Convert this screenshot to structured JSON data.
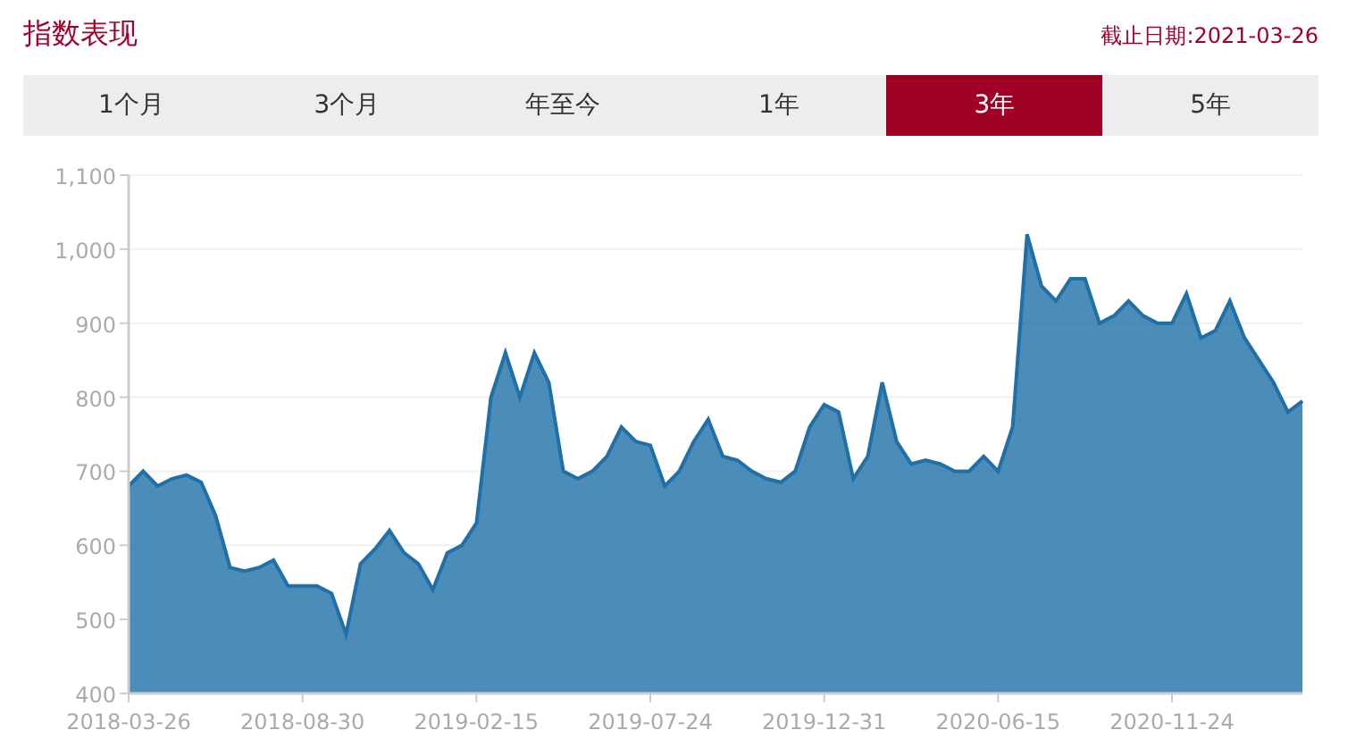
{
  "header": {
    "title": "指数表现",
    "date": "截止日期:2021-03-26"
  },
  "tabs": [
    {
      "label": "1个月",
      "selected": false
    },
    {
      "label": "3个月",
      "selected": false
    },
    {
      "label": "年至今",
      "selected": false
    },
    {
      "label": "1年",
      "selected": false
    },
    {
      "label": "3年",
      "selected": true
    },
    {
      "label": "5年",
      "selected": false
    }
  ],
  "chart": {
    "chart_data": {
      "type": "area",
      "categories": [
        "2018-03-26",
        null,
        null,
        null,
        null,
        null,
        null,
        null,
        null,
        null,
        null,
        null,
        "2018-08-30",
        null,
        null,
        null,
        null,
        null,
        null,
        null,
        null,
        null,
        null,
        null,
        "2019-02-15",
        null,
        null,
        null,
        null,
        null,
        null,
        null,
        null,
        null,
        null,
        null,
        "2019-07-24",
        null,
        null,
        null,
        null,
        null,
        null,
        null,
        null,
        null,
        null,
        null,
        "2019-12-31",
        null,
        null,
        null,
        null,
        null,
        null,
        null,
        null,
        null,
        null,
        null,
        "2020-06-15",
        null,
        null,
        null,
        null,
        null,
        null,
        null,
        null,
        null,
        null,
        null,
        "2020-11-24",
        null,
        null,
        null,
        null,
        null,
        null,
        null,
        null,
        null
      ],
      "series": [
        {
          "color": "#1f6fa8",
          "values": [
            680,
            700,
            680,
            690,
            695,
            685,
            640,
            570,
            565,
            570,
            580,
            545,
            545,
            545,
            535,
            480,
            575,
            595,
            620,
            590,
            575,
            540,
            590,
            600,
            630,
            800,
            860,
            800,
            860,
            820,
            700,
            690,
            700,
            720,
            760,
            740,
            735,
            680,
            700,
            740,
            770,
            720,
            715,
            700,
            690,
            685,
            700,
            760,
            790,
            780,
            690,
            720,
            820,
            740,
            710,
            715,
            710,
            700,
            700,
            720,
            700,
            760,
            1020,
            950,
            930,
            960,
            960,
            900,
            910,
            930,
            910,
            900,
            900,
            940,
            880,
            890,
            930,
            880,
            850,
            820,
            780,
            795
          ]
        }
      ],
      "ylim": [
        400,
        1100
      ],
      "grid": true,
      "yticks": [
        {
          "value": 400,
          "label": "400"
        },
        {
          "value": 500,
          "label": "500"
        },
        {
          "value": 600,
          "label": "600"
        },
        {
          "value": 700,
          "label": "700"
        },
        {
          "value": 800,
          "label": "800"
        },
        {
          "value": 900,
          "label": "900"
        },
        {
          "value": 1000,
          "label": "1,000"
        },
        {
          "value": 1100,
          "label": "1,100"
        }
      ]
    }
  }
}
